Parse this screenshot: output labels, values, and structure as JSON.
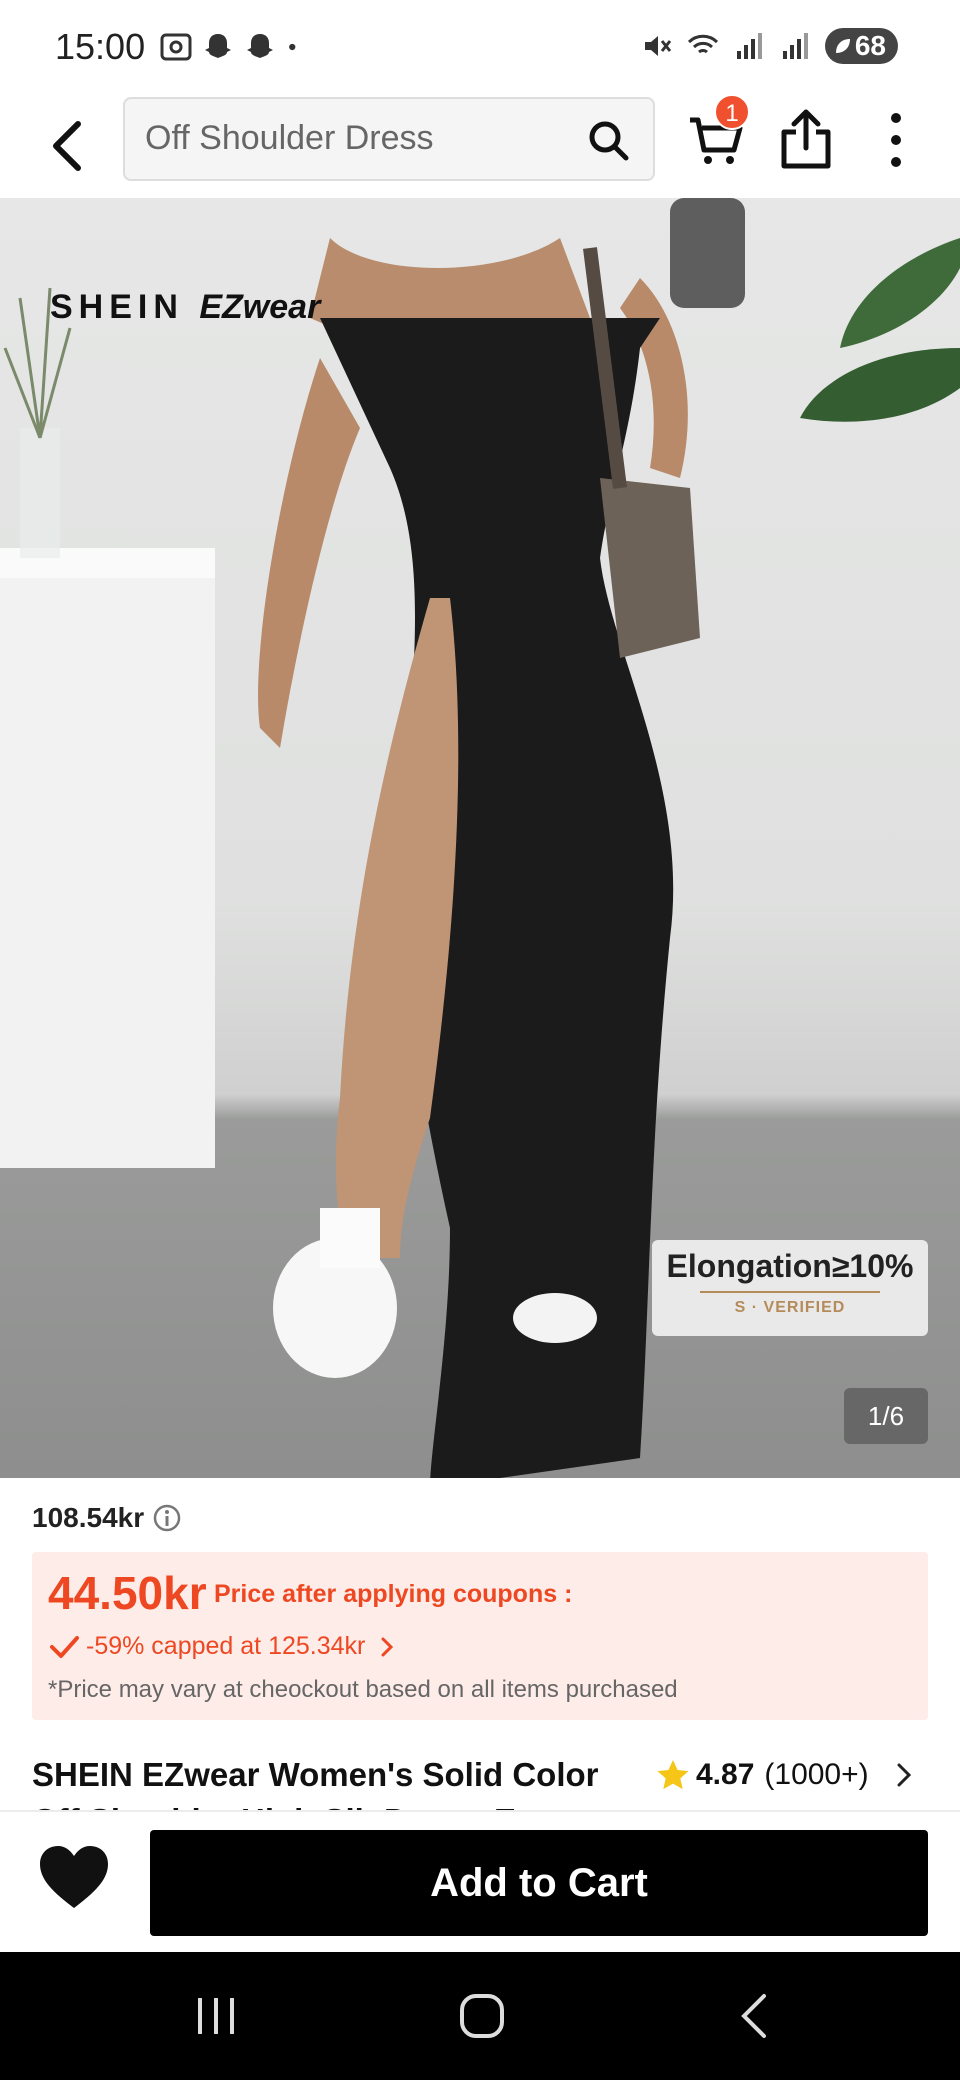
{
  "status_bar": {
    "time": "15:00",
    "battery": "68",
    "left_icons": [
      "screenshot-icon",
      "snapchat-icon",
      "snapchat-icon",
      "dot-icon"
    ],
    "right_icons": [
      "mute-icon",
      "wifi-icon",
      "signal-icon",
      "signal-icon"
    ]
  },
  "top_nav": {
    "search_text": "Off Shoulder Dress",
    "cart_count": "1"
  },
  "hero": {
    "brand_prefix": "SHEIN ",
    "brand_suffix": "EZwear",
    "elongation_title": "Elongation≥10%",
    "elongation_verified": "S · VERIFIED",
    "page_indicator": "1/6",
    "image_index": 1,
    "image_count": 6
  },
  "price": {
    "original": "108.54kr",
    "coupon_price": "44.50kr",
    "coupon_label": "Price after applying coupons :",
    "discount_text": "-59% capped at 125.34kr",
    "note": "*Price may vary at cheockout based on all items purchased"
  },
  "product": {
    "title": "SHEIN EZwear Women's Solid Color Off Shoulder High Slit Dress, Ea...",
    "rating": "4.87",
    "review_count": "(1000+)"
  },
  "actions": {
    "add_to_cart": "Add to Cart"
  },
  "colors": {
    "accent": "#ee4823",
    "coupon_bg": "#fdece8",
    "badge": "#f0502e",
    "star": "#f5c518"
  }
}
